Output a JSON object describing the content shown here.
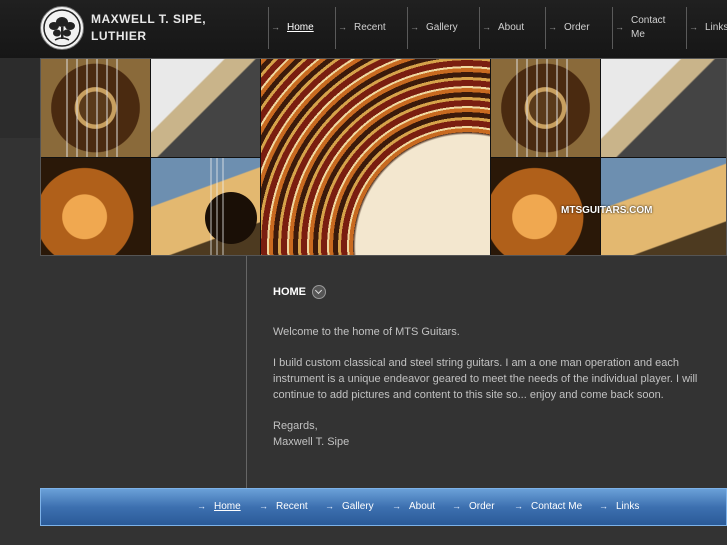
{
  "site": {
    "brand": "MAXWELL T. SIPE, LUTHIER",
    "logo_icon": "tree-seal-icon"
  },
  "nav": {
    "items": [
      {
        "label": "Home",
        "active": true
      },
      {
        "label": "Recent"
      },
      {
        "label": "Gallery"
      },
      {
        "label": "About"
      },
      {
        "label": "Order"
      },
      {
        "label": "Contact Me"
      },
      {
        "label": "Links"
      }
    ],
    "arrow_icon": "arrow-right-icon"
  },
  "banner": {
    "watermark": "MTSGUITARS.COM"
  },
  "content": {
    "heading": "HOME",
    "heading_icon": "chevron-down-circle-icon",
    "paragraphs": [
      "Welcome to the home of MTS Guitars.",
      "I build custom classical and steel string guitars.  I am a one man operation and each instrument is a unique endeavor geared to meet the needs of the individual player.  I will continue to add pictures and content to this site so... enjoy and come back soon."
    ],
    "signoff": "Regards,",
    "signature": "Maxwell T. Sipe"
  },
  "footer_nav": {
    "items": [
      {
        "label": "Home",
        "active": true
      },
      {
        "label": "Recent"
      },
      {
        "label": "Gallery"
      },
      {
        "label": "About"
      },
      {
        "label": "Order"
      },
      {
        "label": "Contact Me"
      },
      {
        "label": "Links"
      }
    ]
  },
  "colors": {
    "page_bg": "#333333",
    "footer_bar": "#3d70b0"
  }
}
